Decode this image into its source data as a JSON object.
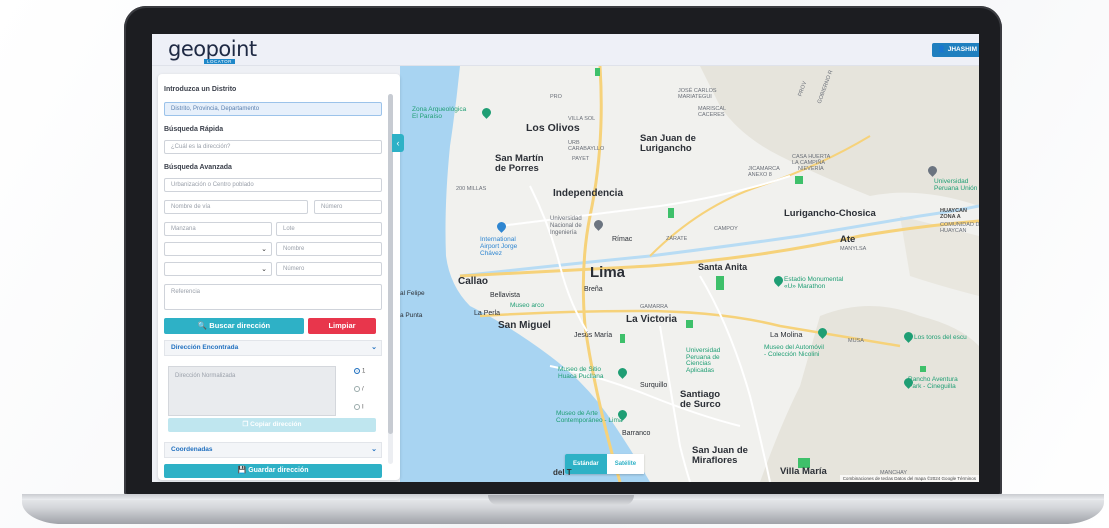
{
  "app": {
    "logo": "geopoint",
    "logo_sub": "LOCATOR",
    "user_button": "JHASHIM"
  },
  "panel": {
    "district_label": "Introduzca un Distrito",
    "district_value": "Distrito, Provincia, Departamento",
    "quick_label": "Búsqueda Rápida",
    "quick_placeholder": "¿Cuál es la dirección?",
    "advanced_label": "Búsqueda Avanzada",
    "urbanizacion_placeholder": "Urbanización o Centro poblado",
    "via_placeholder": "Nombre de vía",
    "numero_placeholder": "Número",
    "manzana_placeholder": "Manzana",
    "lote_placeholder": "Lote",
    "nombre_placeholder": "Nombre",
    "numero2_placeholder": "Número",
    "referencia_placeholder": "Referencia",
    "buscar_button": "Buscar dirección",
    "limpiar_button": "Limpiar",
    "found_section": "Dirección Encontrada",
    "normalized_placeholder": "Dirección Normalizada",
    "radio_options": [
      "1",
      "/",
      "I"
    ],
    "copiar_button": "Copiar dirección",
    "coordenadas_section": "Coordenadas",
    "guardar_button": "Guardar dirección"
  },
  "map": {
    "labels": {
      "los_olivos": "Los Olivos",
      "sjl": "San Juan de\nLurigancho",
      "smp": "San Martín\nde Porres",
      "independencia": "Independencia",
      "lima": "Lima",
      "callao": "Callao",
      "brena": "Breña",
      "santa_anita": "Santa Anita",
      "lurigancho": "Lurigancho-Chosica",
      "ate": "Ate",
      "san_miguel": "San Miguel",
      "la_victoria": "La Victoria",
      "la_molina": "La Molina",
      "santiago": "Santiago\nde Surco",
      "surquillo": "Surquillo",
      "sjm": "San Juan de\nMiraflores",
      "villa_maria": "Villa María",
      "rimac": "Rímac",
      "bellavista": "Bellavista",
      "la_perla": "La Perla",
      "jesus_maria": "Jesús María",
      "barranco": "Barranco",
      "zarate": "ZÁRATE",
      "campoy": "CAMPOY",
      "jicamarca": "JICAMARCA\nANEXO 8",
      "uro": "URB\nCARABAYLLO",
      "zona_arq": "Zona Arqueológica\nEl Paraíso",
      "airport": "International\nAirport Jorge\nChávez",
      "uni": "Universidad\nNacional de\nIngeniería",
      "estadio": "Estadio Monumental\n«U» Marathon",
      "upc": "Universidad\nPeruana de\nCiencias\nAplicadas",
      "museo_auto": "Museo del Automóvil\n- Colección Nicolini",
      "museo_sitio": "Museo de Sitio\nHuaca Pucllana",
      "museo_arte": "Museo de Arte\nContemporáneo - Lima",
      "rancho": "Rancho Aventura\nPark - Cineguilla",
      "toros": "Los toros del escu",
      "upeu": "Universidad\nPeruana Unión",
      "huaycan": "HUAYCAN\nZONA A",
      "museo_marco": "Museo arco",
      "felipe": "al Felipe",
      "punta": "a Punta",
      "mariscal": "MARISCAL\nCACERES",
      "jose_carlos": "JOSÉ CARLOS\nMARIATEGUI",
      "villa_sol": "VILLA SOL",
      "casa_huerta": "CASA HUERTA\nLA CAMPIÑA",
      "nievería": "NIEVERÍA",
      "manylsa": "MANYLSA",
      "payet": "PAYET",
      "musa": "MUSA",
      "gamarra": "GAMARRA",
      "millas": "200 MILLAS",
      "prov": "PROV",
      "gobierno": "GOBIERNO R",
      "pro": "PRO",
      "manchay": "MANCHAY",
      "comunidad": "COMUNIDAD DE\nHUAYCAN"
    },
    "map_type_standard": "Estándar",
    "map_type_satellite": "Satélite",
    "attribution": "Combinaciones de teclas   Datos del mapa ©2024 Google   Términos",
    "google": "Google",
    "del_t": "del T"
  },
  "colors": {
    "accent": "#2eb1c6",
    "danger": "#e8364c",
    "brand": "#1f88c9",
    "water": "#a8d4f2",
    "park": "#3ec06a"
  }
}
